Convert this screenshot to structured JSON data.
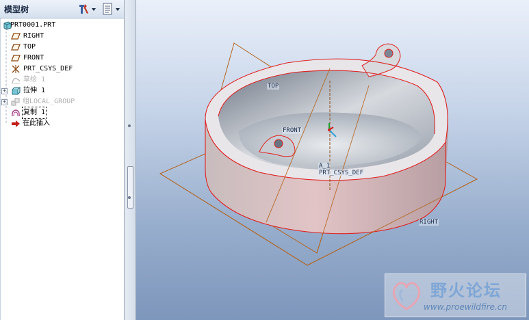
{
  "tree": {
    "title": "模型树",
    "items": [
      {
        "label": "PRT0001.PRT"
      },
      {
        "label": "RIGHT"
      },
      {
        "label": "TOP"
      },
      {
        "label": "FRONT"
      },
      {
        "label": "PRT_CSYS_DEF"
      },
      {
        "label": "草绘 1"
      },
      {
        "label": "拉伸 1"
      },
      {
        "label": "组LOCAL_GROUP"
      },
      {
        "label": "复制 1"
      },
      {
        "label": "在此插入"
      }
    ]
  },
  "viewport": {
    "datum_labels": {
      "top": "TOP",
      "front": "FRONT",
      "right": "RIGHT",
      "axis": "A_1",
      "csys": "PRT_CSYS_DEF"
    }
  },
  "watermark": {
    "title": "野火论坛",
    "url": "www.proewildfire.cn"
  },
  "colors": {
    "edge_highlight": "#e02020",
    "datum_plane": "#b4641e",
    "part_surface": "#c9c9cd"
  }
}
